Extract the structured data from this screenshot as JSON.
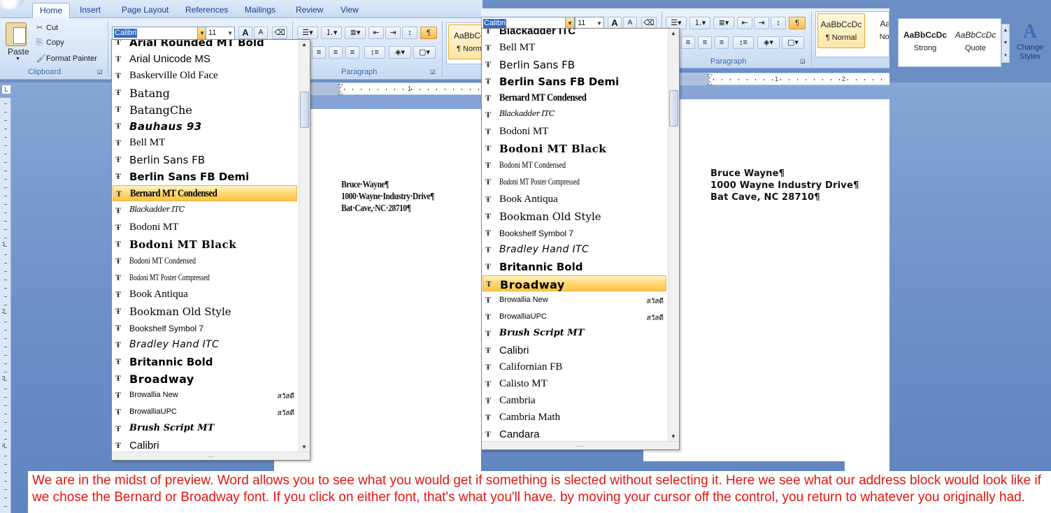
{
  "ribbon": {
    "tabs": [
      "Home",
      "Insert",
      "Page Layout",
      "References",
      "Mailings",
      "Review",
      "View"
    ],
    "active_tab": "Home",
    "clipboard": {
      "paste_label": "Paste",
      "cut_label": "Cut",
      "copy_label": "Copy",
      "format_painter_label": "Format Painter",
      "group_label": "Clipboard"
    },
    "font_name_value": "Calibri",
    "font_size_value": "11",
    "grow_font_label": "A",
    "shrink_font_label": "A",
    "paragraph_group_label": "Paragraph",
    "pilcrow_label": "¶",
    "styles_left": [
      {
        "sample": "AaBbCc",
        "name": "¶ Norm"
      }
    ],
    "styles_right": [
      {
        "sample": "AaBbCcDc",
        "name": "¶ Normal"
      },
      {
        "sample": "AaBb",
        "name": "No Sp"
      },
      {
        "sample": "AaBbCcDc",
        "name": "Strong"
      },
      {
        "sample": "AaBbCcDc",
        "name": "Quote"
      }
    ],
    "change_styles_label": "Change Styles"
  },
  "dropdown_left": {
    "selected": "Bernard MT Condensed",
    "items": [
      {
        "name": "Arial Rounded MT Bold",
        "cls": "f-rounded",
        "thai": ""
      },
      {
        "name": "Arial Unicode MS",
        "cls": "f-sans",
        "thai": ""
      },
      {
        "name": "Baskerville Old Face",
        "cls": "f-serif",
        "thai": ""
      },
      {
        "name": "Batang",
        "cls": "f-batang",
        "thai": ""
      },
      {
        "name": "BatangChe",
        "cls": "f-batang",
        "thai": ""
      },
      {
        "name": "Bauhaus 93",
        "cls": "f-bauhaus",
        "thai": ""
      },
      {
        "name": "Bell MT",
        "cls": "f-serif",
        "thai": ""
      },
      {
        "name": "Berlin Sans FB",
        "cls": "f-berlin",
        "thai": ""
      },
      {
        "name": "Berlin Sans FB Demi",
        "cls": "f-berlinb",
        "thai": ""
      },
      {
        "name": "Bernard MT Condensed",
        "cls": "f-condensed",
        "thai": ""
      },
      {
        "name": "Blackadder ITC",
        "cls": "f-script",
        "thai": ""
      },
      {
        "name": "Bodoni MT",
        "cls": "f-serif",
        "thai": ""
      },
      {
        "name": "Bodoni MT Black",
        "cls": "f-bodoniblack",
        "thai": ""
      },
      {
        "name": "Bodoni MT Condensed",
        "cls": "f-bodonicond",
        "thai": ""
      },
      {
        "name": "Bodoni MT Poster Compressed",
        "cls": "f-bodoniposter",
        "thai": ""
      },
      {
        "name": "Book Antiqua",
        "cls": "f-serif",
        "thai": ""
      },
      {
        "name": "Bookman Old Style",
        "cls": "f-bookman",
        "thai": ""
      },
      {
        "name": "Bookshelf Symbol 7",
        "cls": "f-small",
        "thai": ""
      },
      {
        "name": "Bradley Hand ITC",
        "cls": "f-bradley",
        "thai": ""
      },
      {
        "name": "Britannic Bold",
        "cls": "f-britannic",
        "thai": ""
      },
      {
        "name": "Broadway",
        "cls": "f-broadway",
        "thai": ""
      },
      {
        "name": "Browallia New",
        "cls": "f-tiny",
        "thai": "สวัสดี"
      },
      {
        "name": "BrowalliaUPC",
        "cls": "f-tiny",
        "thai": "สวัสดี"
      },
      {
        "name": "Brush Script MT",
        "cls": "f-brush",
        "thai": ""
      },
      {
        "name": "Calibri",
        "cls": "f-sans",
        "thai": ""
      }
    ]
  },
  "dropdown_right": {
    "selected": "Broadway",
    "items": [
      {
        "name": "Blackadder ITC",
        "cls": "f-cut",
        "thai": ""
      },
      {
        "name": "Bell MT",
        "cls": "f-serif",
        "thai": ""
      },
      {
        "name": "Berlin Sans FB",
        "cls": "f-berlin",
        "thai": ""
      },
      {
        "name": "Berlin Sans FB Demi",
        "cls": "f-berlinb",
        "thai": ""
      },
      {
        "name": "Bernard MT Condensed",
        "cls": "f-condensed",
        "thai": ""
      },
      {
        "name": "Blackadder ITC",
        "cls": "f-script",
        "thai": ""
      },
      {
        "name": "Bodoni MT",
        "cls": "f-serif",
        "thai": ""
      },
      {
        "name": "Bodoni MT Black",
        "cls": "f-bodoniblack",
        "thai": ""
      },
      {
        "name": "Bodoni MT Condensed",
        "cls": "f-bodonicond",
        "thai": ""
      },
      {
        "name": "Bodoni MT Poster Compressed",
        "cls": "f-bodoniposter",
        "thai": ""
      },
      {
        "name": "Book Antiqua",
        "cls": "f-serif",
        "thai": ""
      },
      {
        "name": "Bookman Old Style",
        "cls": "f-bookman",
        "thai": ""
      },
      {
        "name": "Bookshelf Symbol 7",
        "cls": "f-small",
        "thai": ""
      },
      {
        "name": "Bradley Hand ITC",
        "cls": "f-bradley",
        "thai": ""
      },
      {
        "name": "Britannic Bold",
        "cls": "f-britannic",
        "thai": ""
      },
      {
        "name": "Broadway",
        "cls": "f-broadway",
        "thai": ""
      },
      {
        "name": "Browallia New",
        "cls": "f-tiny",
        "thai": "สวัสดี"
      },
      {
        "name": "BrowalliaUPC",
        "cls": "f-tiny",
        "thai": "สวัสดี"
      },
      {
        "name": "Brush Script MT",
        "cls": "f-brush",
        "thai": ""
      },
      {
        "name": "Calibri",
        "cls": "f-sans",
        "thai": ""
      },
      {
        "name": "Californian FB",
        "cls": "f-serif",
        "thai": ""
      },
      {
        "name": "Calisto MT",
        "cls": "f-serif",
        "thai": ""
      },
      {
        "name": "Cambria",
        "cls": "f-serif",
        "thai": ""
      },
      {
        "name": "Cambria Math",
        "cls": "f-serif",
        "thai": ""
      },
      {
        "name": "Candara",
        "cls": "f-sans",
        "thai": ""
      }
    ]
  },
  "doc_left": {
    "address": [
      "Bruce·Wayne¶",
      "1000·Wayne·Industry·Drive¶",
      "Bat·Cave,·NC·28710¶"
    ]
  },
  "doc_right": {
    "address": [
      "Bruce Wayne¶",
      "1000 Wayne Industry Drive¶",
      "Bat Cave, NC 28710¶"
    ]
  },
  "ruler": {
    "left_numbers": [
      "1"
    ],
    "right_numbers": [
      "1",
      "2"
    ],
    "vertical_numbers": [
      "1",
      "2",
      "3",
      "4"
    ]
  },
  "caption": {
    "text": "We are in the midst of preview. Word allows you to see what you would get if something is slected without selecting it. Here we see what our address block would look like if we chose the Bernard or Broadway font. If you click on either font, that's what you'll have. by moving your cursor off the control, you return to whatever you originally had."
  },
  "colors": {
    "caption_text": "#e8140f",
    "highlight": "#fbc54a",
    "ribbon": "#d7e5f7",
    "workspace": "#6f90c8"
  }
}
